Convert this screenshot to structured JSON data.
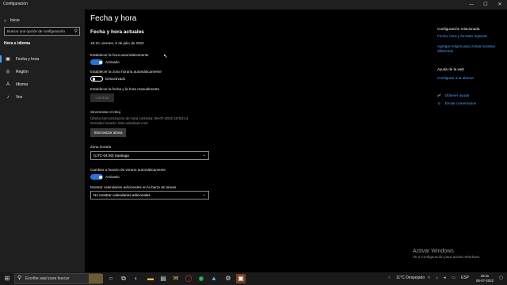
{
  "window": {
    "title": "Configuración",
    "controls": [
      "—",
      "☐",
      "✕"
    ]
  },
  "sidebar": {
    "home_label": "Inicio",
    "search_placeholder": "Buscar una opción de configuración",
    "section_title": "Hora e idioma",
    "items": [
      {
        "label": "Fecha y hora",
        "icon": "calendar-clock-icon",
        "active": true
      },
      {
        "label": "Región",
        "icon": "globe-icon"
      },
      {
        "label": "Idioma",
        "icon": "language-icon"
      },
      {
        "label": "Voz",
        "icon": "microphone-icon"
      }
    ]
  },
  "main": {
    "page_title": "Fecha y hora",
    "current_heading": "Fecha y hora actuales",
    "current_datetime": "19:10, viernes, 8 de julio de 2022",
    "auto_time": {
      "label": "Establecer la hora automáticamente",
      "state": "Activado",
      "on": true
    },
    "auto_zone": {
      "label": "Establecer la zona horaria automáticamente",
      "state": "Desactivado",
      "on": false
    },
    "manual": {
      "label": "Establecer la fecha y la hora manualmente",
      "button": "Cambiar"
    },
    "sync": {
      "heading": "Sincronizar el reloj",
      "last_sync": "Última sincronización de hora correcta: 08-07-2022 18:53:14",
      "server": "Servidor horario: time.windows.com",
      "button": "Sincronizar ahora"
    },
    "timezone": {
      "label": "Zona horaria",
      "value": "(UTC-04:00) Santiago"
    },
    "dst": {
      "label": "Cambiar a horario de verano automáticamente",
      "state": "Activado",
      "on": true
    },
    "calendars": {
      "label": "Mostrar calendarios adicionales en la barra de tareas",
      "value": "No mostrar calendarios adicionales"
    }
  },
  "related": {
    "title": "Configuración relacionada",
    "links": [
      "Fecha, hora y formato regional",
      "Agregar relojes para zonas horarias diferentes"
    ],
    "help_title": "Ayuda de la web",
    "help_link": "Configurar una alarma",
    "get_help": "Obtener ayuda",
    "feedback": "Enviar comentarios"
  },
  "activation": {
    "title": "Activar Windows",
    "subtitle": "Ve a Configuración para activar Windows."
  },
  "taskbar": {
    "search_placeholder": "Escribe aquí para buscar",
    "weather": "11°C  Despejado",
    "language": "ESP",
    "time": "19:11",
    "date": "08-07-2022"
  }
}
